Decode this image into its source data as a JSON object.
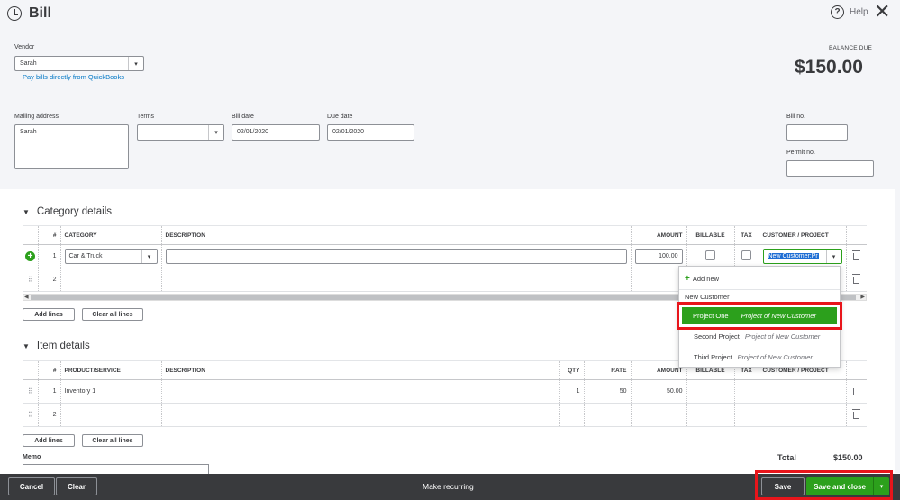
{
  "header": {
    "title": "Bill",
    "help_label": "Help",
    "balance_due_label": "BALANCE DUE",
    "balance_due_value": "$150.00"
  },
  "vendor": {
    "label": "Vendor",
    "value": "Sarah",
    "pay_link": "Pay bills directly from QuickBooks"
  },
  "mailing": {
    "label": "Mailing address",
    "value": "Sarah"
  },
  "terms": {
    "label": "Terms",
    "value": ""
  },
  "bill_date": {
    "label": "Bill date",
    "value": "02/01/2020"
  },
  "due_date": {
    "label": "Due date",
    "value": "02/01/2020"
  },
  "bill_no": {
    "label": "Bill no.",
    "value": ""
  },
  "permit_no": {
    "label": "Permit no.",
    "value": ""
  },
  "category_details": {
    "title": "Category details",
    "columns": [
      "#",
      "CATEGORY",
      "DESCRIPTION",
      "AMOUNT",
      "BILLABLE",
      "TAX",
      "CUSTOMER / PROJECT"
    ],
    "rows": [
      {
        "num": "1",
        "category": "Car & Truck",
        "description": "",
        "amount": "100.00",
        "customer": "New Customer:Pr"
      },
      {
        "num": "2",
        "category": "",
        "description": "",
        "amount": "",
        "customer": ""
      }
    ],
    "add_lines": "Add lines",
    "clear_lines": "Clear all lines"
  },
  "dropdown": {
    "add_new": "Add new",
    "items": [
      {
        "name": "New Customer",
        "sub": ""
      },
      {
        "name": "Project One",
        "sub": "Project of New Customer"
      },
      {
        "name": "Second Project",
        "sub": "Project of New Customer"
      },
      {
        "name": "Third Project",
        "sub": "Project of New Customer"
      }
    ]
  },
  "item_details": {
    "title": "Item details",
    "columns": [
      "#",
      "PRODUCT/SERVICE",
      "DESCRIPTION",
      "QTY",
      "RATE",
      "AMOUNT",
      "BILLABLE",
      "TAX",
      "CUSTOMER / PROJECT"
    ],
    "rows": [
      {
        "num": "1",
        "product": "Inventory 1",
        "description": "",
        "qty": "1",
        "rate": "50",
        "amount": "50.00"
      },
      {
        "num": "2",
        "product": "",
        "description": "",
        "qty": "",
        "rate": "",
        "amount": ""
      }
    ],
    "add_lines": "Add lines",
    "clear_lines": "Clear all lines"
  },
  "totals": {
    "label": "Total",
    "value": "$150.00"
  },
  "memo": {
    "label": "Memo"
  },
  "footer": {
    "cancel": "Cancel",
    "clear": "Clear",
    "make_recurring": "Make recurring",
    "save": "Save",
    "save_and_close": "Save and close"
  },
  "colors": {
    "accent_green": "#2ca01c",
    "highlight_red": "#e8151b",
    "footer_bg": "#393a3d"
  }
}
